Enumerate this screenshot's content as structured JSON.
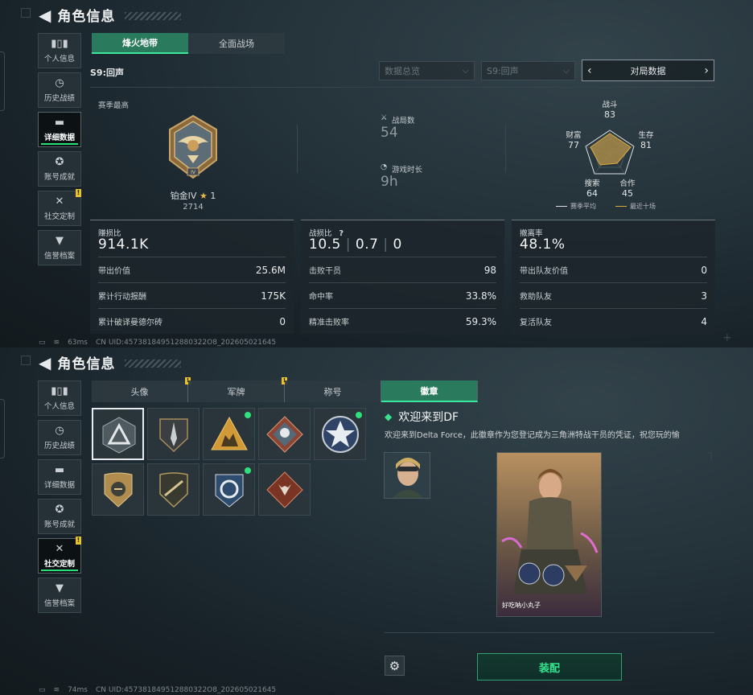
{
  "header": {
    "title": "角色信息"
  },
  "sidebar": {
    "items": [
      {
        "label": "个人信息",
        "icon": "bar-chart-icon"
      },
      {
        "label": "历史战绩",
        "icon": "clock-icon"
      },
      {
        "label": "详细数据",
        "icon": "folder-icon"
      },
      {
        "label": "账号成就",
        "icon": "medal-icon"
      },
      {
        "label": "社交定制",
        "icon": "tools-icon"
      },
      {
        "label": "信誉档案",
        "icon": "shield-icon"
      }
    ],
    "warn_mark": "!"
  },
  "top": {
    "tabs": [
      "烽火地带",
      "全面战场"
    ],
    "season": "S9:回声",
    "dropdown1": "数据总览",
    "dropdown2": "S9:回声",
    "nav_label": "对局数据",
    "season_best": "赛季最高",
    "rank": {
      "name": "铂金IV",
      "stars": "1",
      "score": "2714"
    },
    "battles_label": "战局数",
    "battles_value": "54",
    "time_label": "游戏时长",
    "time_value": "9h",
    "radar": {
      "fight_l": "战斗",
      "fight_v": "83",
      "survive_l": "生存",
      "survive_v": "81",
      "coop_l": "合作",
      "coop_v": "45",
      "search_l": "搜索",
      "search_v": "64",
      "wealth_l": "财富",
      "wealth_v": "77"
    },
    "legend": {
      "avg": "赛季平均",
      "recent": "最近十场"
    },
    "cards": [
      {
        "title": "赚损比",
        "big": "914.1K",
        "rows": [
          {
            "l": "带出价值",
            "v": "25.6M"
          },
          {
            "l": "累计行动报酬",
            "v": "175K"
          },
          {
            "l": "累计破译曼德尔砖",
            "v": "0"
          }
        ]
      },
      {
        "title": "战损比",
        "big_a": "10.5",
        "big_b": "0.7",
        "big_c": "0",
        "help": "?",
        "rows": [
          {
            "l": "击败干员",
            "v": "98"
          },
          {
            "l": "命中率",
            "v": "33.8%"
          },
          {
            "l": "精准击败率",
            "v": "59.3%"
          }
        ]
      },
      {
        "title": "撤离率",
        "big": "48.1%",
        "rows": [
          {
            "l": "带出队友价值",
            "v": "0"
          },
          {
            "l": "救助队友",
            "v": "3"
          },
          {
            "l": "复活队友",
            "v": "4"
          }
        ]
      }
    ],
    "footer": {
      "ping": "63ms",
      "uid": "CN UID:457381849512880322O8_202605021645"
    }
  },
  "bottom": {
    "tabs": [
      "头像",
      "军牌",
      "称号",
      "徽章"
    ],
    "badge_title": "欢迎来到DF",
    "badge_desc": "欢迎来到Delta Force，此徽章作为您登记成为三角洲特战干员的凭证，祝您玩的愉",
    "char_name": "好吃呐小丸子",
    "equip": "装配",
    "footer": {
      "ping": "74ms",
      "uid": "CN UID:457381849512880322O8_202605021645"
    }
  },
  "colors": {
    "accent": "#2a7a5d",
    "green": "#34e58f",
    "gold": "#e9c12e"
  }
}
